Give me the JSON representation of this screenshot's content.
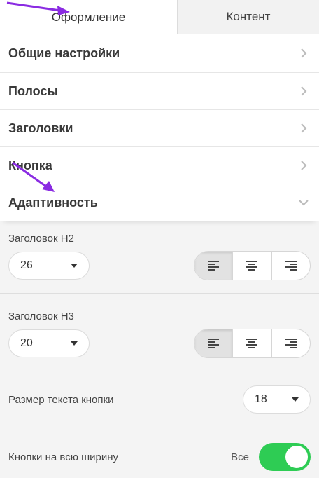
{
  "tabs": [
    {
      "label": "Оформление",
      "active": true
    },
    {
      "label": "Контент",
      "active": false
    }
  ],
  "menu": [
    {
      "label": "Общие настройки",
      "icon": "chevron-right-icon"
    },
    {
      "label": "Полосы",
      "icon": "chevron-right-icon"
    },
    {
      "label": "Заголовки",
      "icon": "chevron-right-icon"
    },
    {
      "label": "Кнопка",
      "icon": "chevron-right-icon"
    },
    {
      "label": "Адаптивность",
      "icon": "chevron-down-icon"
    }
  ],
  "adaptive": {
    "h2": {
      "label": "Заголовок H2",
      "value": "26",
      "alignment": "left"
    },
    "h3": {
      "label": "Заголовок H3",
      "value": "20",
      "alignment": "left"
    },
    "button_text_size": {
      "label": "Размер текста кнопки",
      "value": "18"
    },
    "full_width_buttons": {
      "label": "Кнопки на всю ширину",
      "toggle_text": "Все",
      "enabled": true
    }
  },
  "colors": {
    "accent_green": "#2ecc54",
    "annotation_arrow": "#8a2be2"
  }
}
